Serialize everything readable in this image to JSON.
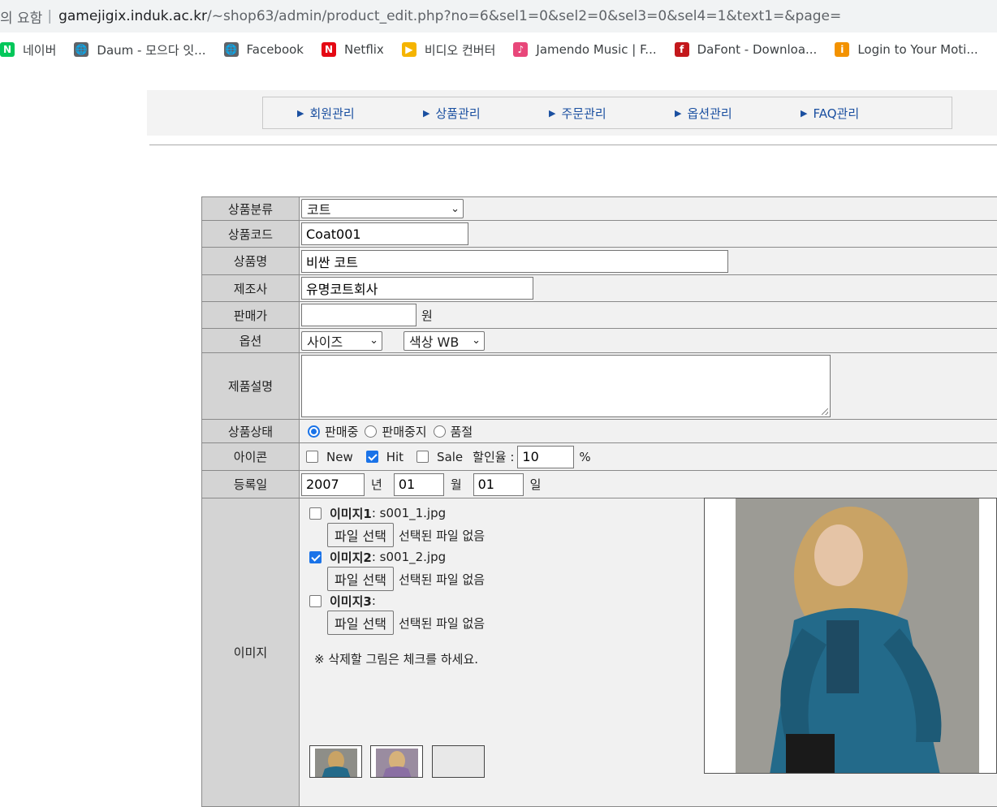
{
  "browser": {
    "security_text": "의 요함",
    "url_host": "gamejigix.induk.ac.kr",
    "url_path": "/~shop63/admin/product_edit.php?no=6&sel1=0&sel2=0&sel3=0&sel4=1&text1=&page=",
    "bookmarks": [
      {
        "label": "네이버",
        "icon": "naver-icon",
        "color": "#03c75a",
        "glyph": "N"
      },
      {
        "label": "Daum - 모으다 잇...",
        "icon": "globe-icon",
        "color": "#5f6368",
        "glyph": "🌐"
      },
      {
        "label": "Facebook",
        "icon": "globe-icon",
        "color": "#5f6368",
        "glyph": "🌐"
      },
      {
        "label": "Netflix",
        "icon": "netflix-icon",
        "color": "#e50914",
        "glyph": "N"
      },
      {
        "label": "비디오 컨버터",
        "icon": "video-icon",
        "color": "#f5b400",
        "glyph": "▶"
      },
      {
        "label": "Jamendo Music | F...",
        "icon": "jamendo-icon",
        "color": "#e8477a",
        "glyph": "♪"
      },
      {
        "label": "DaFont - Downloa...",
        "icon": "dafont-icon",
        "color": "#c3181c",
        "glyph": "f"
      },
      {
        "label": "Login to Your Moti...",
        "icon": "motion-icon",
        "color": "#f39200",
        "glyph": "i"
      }
    ]
  },
  "nav": {
    "items": [
      "회원관리",
      "상품관리",
      "주문관리",
      "옵션관리",
      "FAQ관리"
    ]
  },
  "form": {
    "category_label": "상품분류",
    "category_value": "코트",
    "code_label": "상품코드",
    "code_value": "Coat001",
    "name_label": "상품명",
    "name_value": "비싼 코트",
    "maker_label": "제조사",
    "maker_value": "유명코트회사",
    "price_label": "판매가",
    "price_value": "",
    "price_unit": "원",
    "option_label": "옵션",
    "option1_value": "사이즈",
    "option2_value": "색상  WB",
    "desc_label": "제품설명",
    "desc_value": "",
    "status_label": "상품상태",
    "status_options": [
      "판매중",
      "판매중지",
      "품절"
    ],
    "status_selected": 0,
    "icon_label": "아이콘",
    "icon_new": "New",
    "icon_hit": "Hit",
    "icon_sale": "Sale",
    "icon_new_checked": false,
    "icon_hit_checked": true,
    "icon_sale_checked": false,
    "discount_label": "할인율 :",
    "discount_value": "10",
    "discount_unit": "%",
    "date_label": "등록일",
    "date_year": "2007",
    "date_year_unit": "년",
    "date_month": "01",
    "date_month_unit": "월",
    "date_day": "01",
    "date_day_unit": "일",
    "image_label": "이미지",
    "images": [
      {
        "title": "이미지1",
        "file": ": s001_1.jpg",
        "checked": false
      },
      {
        "title": "이미지2",
        "file": ": s001_2.jpg",
        "checked": true
      },
      {
        "title": "이미지3",
        "file": ":",
        "checked": false
      }
    ],
    "file_button": "파일 선택",
    "file_none": "선택된 파일 없음",
    "delete_note": "※ 삭제할 그림은 체크를 하세요."
  }
}
